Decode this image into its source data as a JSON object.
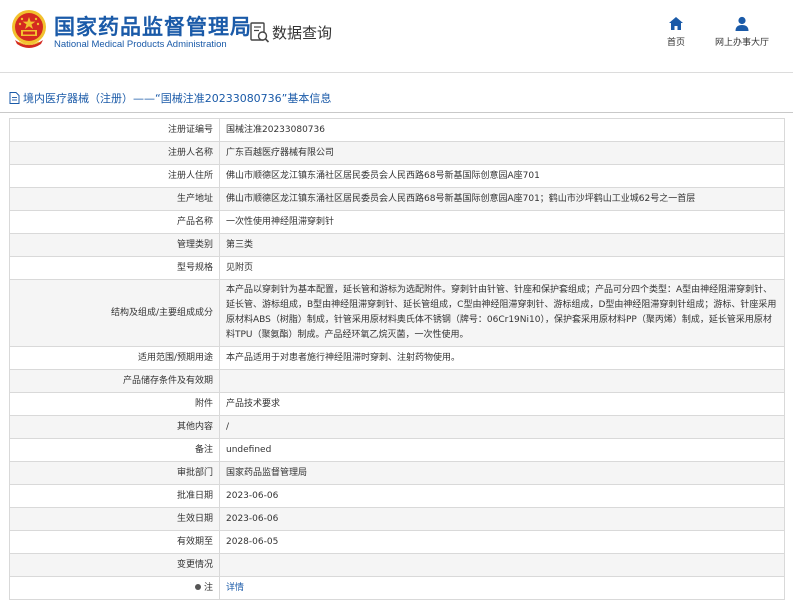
{
  "header": {
    "org_name_cn": "国家药品监督管理局",
    "org_name_en": "National Medical Products Administration",
    "query_title": "数据查询",
    "nav": {
      "home_label": "首页",
      "hall_label": "网上办事大厅"
    },
    "icons": [
      "emblem-logo",
      "data-query-icon",
      "home-icon",
      "user-icon"
    ]
  },
  "breadcrumb": {
    "text": "境内医疗器械（注册）——“国械注准20233080736”基本信息"
  },
  "rows": [
    {
      "label": "注册证编号",
      "value": "国械注准20233080736"
    },
    {
      "label": "注册人名称",
      "value": "广东百越医疗器械有限公司"
    },
    {
      "label": "注册人住所",
      "value": "佛山市顺德区龙江镇东涌社区居民委员会人民西路68号新基国际创意园A座701"
    },
    {
      "label": "生产地址",
      "value": "佛山市顺德区龙江镇东涌社区居民委员会人民西路68号新基国际创意园A座701；鹤山市沙坪鹤山工业城62号之一首层"
    },
    {
      "label": "产品名称",
      "value": "一次性使用神经阻滞穿刺针"
    },
    {
      "label": "管理类别",
      "value": "第三类"
    },
    {
      "label": "型号规格",
      "value": "见附页"
    },
    {
      "label": "结构及组成/主要组成成分",
      "value": "本产品以穿刺针为基本配置，延长管和游标为选配附件。穿刺针由针管、针座和保护套组成；产品可分四个类型：A型由神经阻滞穿刺针、延长管、游标组成，B型由神经阻滞穿刺针、延长管组成，C型由神经阻滞穿刺针、游标组成，D型由神经阻滞穿刺针组成；游标、针座采用原材料ABS（树脂）制成，针管采用原材料奥氏体不锈钢（牌号：06Cr19Ni10），保护套采用原材料PP（聚丙烯）制成，延长管采用原材料TPU（聚氨酯）制成。产品经环氧乙烷灭菌，一次性使用。"
    },
    {
      "label": "适用范围/预期用途",
      "value": "本产品适用于对患者施行神经阻滞时穿刺、注射药物使用。"
    },
    {
      "label": "产品储存条件及有效期",
      "value": ""
    },
    {
      "label": "附件",
      "value": "产品技术要求"
    },
    {
      "label": "其他内容",
      "value": "/"
    },
    {
      "label": "备注",
      "value": "undefined"
    },
    {
      "label": "审批部门",
      "value": "国家药品监督管理局"
    },
    {
      "label": "批准日期",
      "value": "2023-06-06"
    },
    {
      "label": "生效日期",
      "value": "2023-06-06"
    },
    {
      "label": "有效期至",
      "value": "2028-06-05"
    },
    {
      "label": "变更情况",
      "value": ""
    },
    {
      "label": "注",
      "value": "详情"
    }
  ],
  "colors": {
    "brand_blue": "#1a5aa8",
    "emblem_red": "#d42a20",
    "emblem_gold": "#f2c12e",
    "row_alt_bg": "#f5f5f5",
    "border": "#d9d9d9"
  }
}
